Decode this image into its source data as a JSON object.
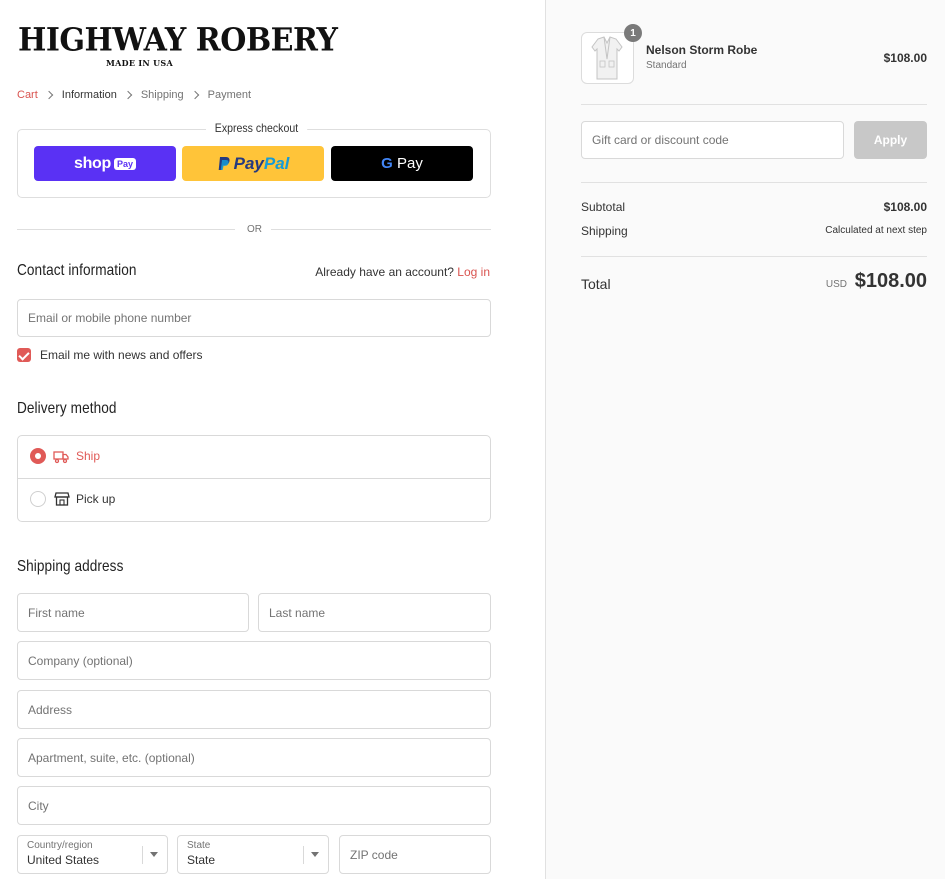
{
  "brand": {
    "name": "HIGHWAY ROBERY",
    "tagline": "MADE IN USA"
  },
  "breadcrumb": {
    "items": [
      {
        "label": "Cart",
        "state": "link"
      },
      {
        "label": "Information",
        "state": "current"
      },
      {
        "label": "Shipping",
        "state": "upcoming"
      },
      {
        "label": "Payment",
        "state": "upcoming"
      }
    ]
  },
  "express": {
    "title": "Express checkout",
    "shop_pay": {
      "word": "shop",
      "pill": "Pay"
    },
    "paypal": {
      "a": "Pay",
      "b": "Pal"
    },
    "gpay": {
      "g": "G",
      "text": " Pay"
    },
    "or": "OR"
  },
  "contact": {
    "heading": "Contact information",
    "account_prompt": "Already have an account?",
    "login_label": "Log in",
    "email_placeholder": "Email or mobile phone number",
    "newsletter_label": "Email me with news and offers",
    "newsletter_checked": true
  },
  "delivery": {
    "heading": "Delivery method",
    "options": [
      {
        "label": "Ship",
        "selected": true,
        "icon": "truck-icon"
      },
      {
        "label": "Pick up",
        "selected": false,
        "icon": "store-icon"
      }
    ]
  },
  "shipping_address": {
    "heading": "Shipping address",
    "first_name": "First name",
    "last_name": "Last name",
    "company": "Company (optional)",
    "address": "Address",
    "apartment": "Apartment, suite, etc. (optional)",
    "city": "City",
    "country": {
      "label": "Country/region",
      "value": "United States"
    },
    "state": {
      "label": "State",
      "value": "State"
    },
    "zip": "ZIP code"
  },
  "summary": {
    "product": {
      "name": "Nelson Storm Robe",
      "variant": "Standard",
      "price": "$108.00",
      "quantity": "1"
    },
    "discount_placeholder": "Gift card or discount code",
    "apply_label": "Apply",
    "subtotal_label": "Subtotal",
    "subtotal_value": "$108.00",
    "shipping_label": "Shipping",
    "shipping_value": "Calculated at next step",
    "total_label": "Total",
    "currency": "USD",
    "total_value": "$108.00"
  },
  "colors": {
    "accent": "#e05a57",
    "shop_pay": "#5a31f4",
    "paypal": "#ffc439",
    "gpay": "#000000"
  }
}
